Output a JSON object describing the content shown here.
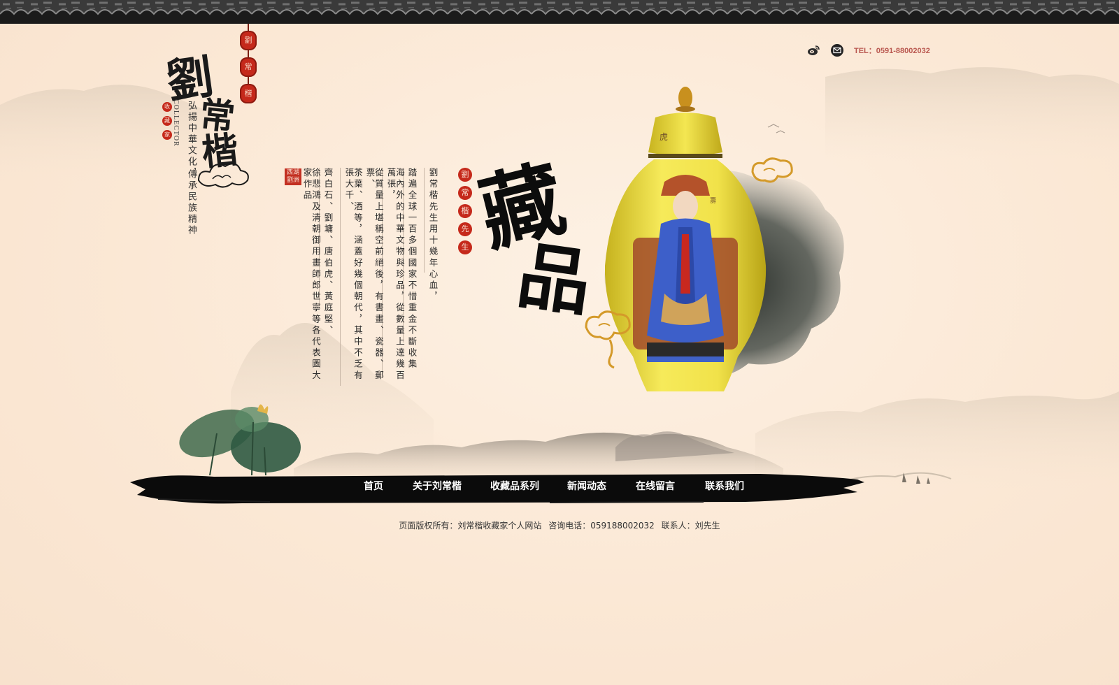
{
  "logo": {
    "name_chars": [
      "劉",
      "常",
      "楷"
    ],
    "lantern_chars": [
      "劉",
      "常",
      "楷"
    ],
    "collector_en": "COLLECTOR",
    "collector_seal": [
      "收",
      "藏",
      "家"
    ],
    "slogan_lines": [
      "弘揚中華文化，",
      "傳承民族精神"
    ]
  },
  "header": {
    "tel": "TEL：0591-88002032",
    "icons": [
      "weibo-icon",
      "mail-icon"
    ]
  },
  "intro": {
    "square_seal": "西湖劉洲",
    "title_seals": [
      "劉",
      "常",
      "楷",
      "先",
      "生"
    ],
    "columns": [
      "劉常楷先生用十幾年心血，",
      "踏遍全球一百多個國家不惜重金不斷收集",
      "海內外的中華文物與珍品，從數量上達幾百萬張，",
      "從質量上堪稱空前絕後，有書畫、瓷器、郵票、",
      "茶葉、酒等，涵蓋好幾個朝代，其中不乏有張大千、",
      "齊白石、劉墉、唐伯虎、黃庭堅、",
      "徐悲鴻及清朝御用畫師郎世寧等各代表圖大家作品"
    ],
    "calligraphy": [
      "藏",
      "品"
    ]
  },
  "nav": {
    "items": [
      "首页",
      "关于刘常楷",
      "收藏品系列",
      "新闻动态",
      "在线留言",
      "联系我们"
    ]
  },
  "footer": {
    "copyright": "页面版权所有：刘常楷收藏家个人网站",
    "phone": "咨询电话：059188002032",
    "contact": "联系人：刘先生"
  },
  "colors": {
    "background": "#fbe9d8",
    "seal_red": "#c5291b",
    "tel_red": "#b9574f",
    "vase_yellow": "#f1e24a",
    "ink_black": "#0c0c0c"
  }
}
